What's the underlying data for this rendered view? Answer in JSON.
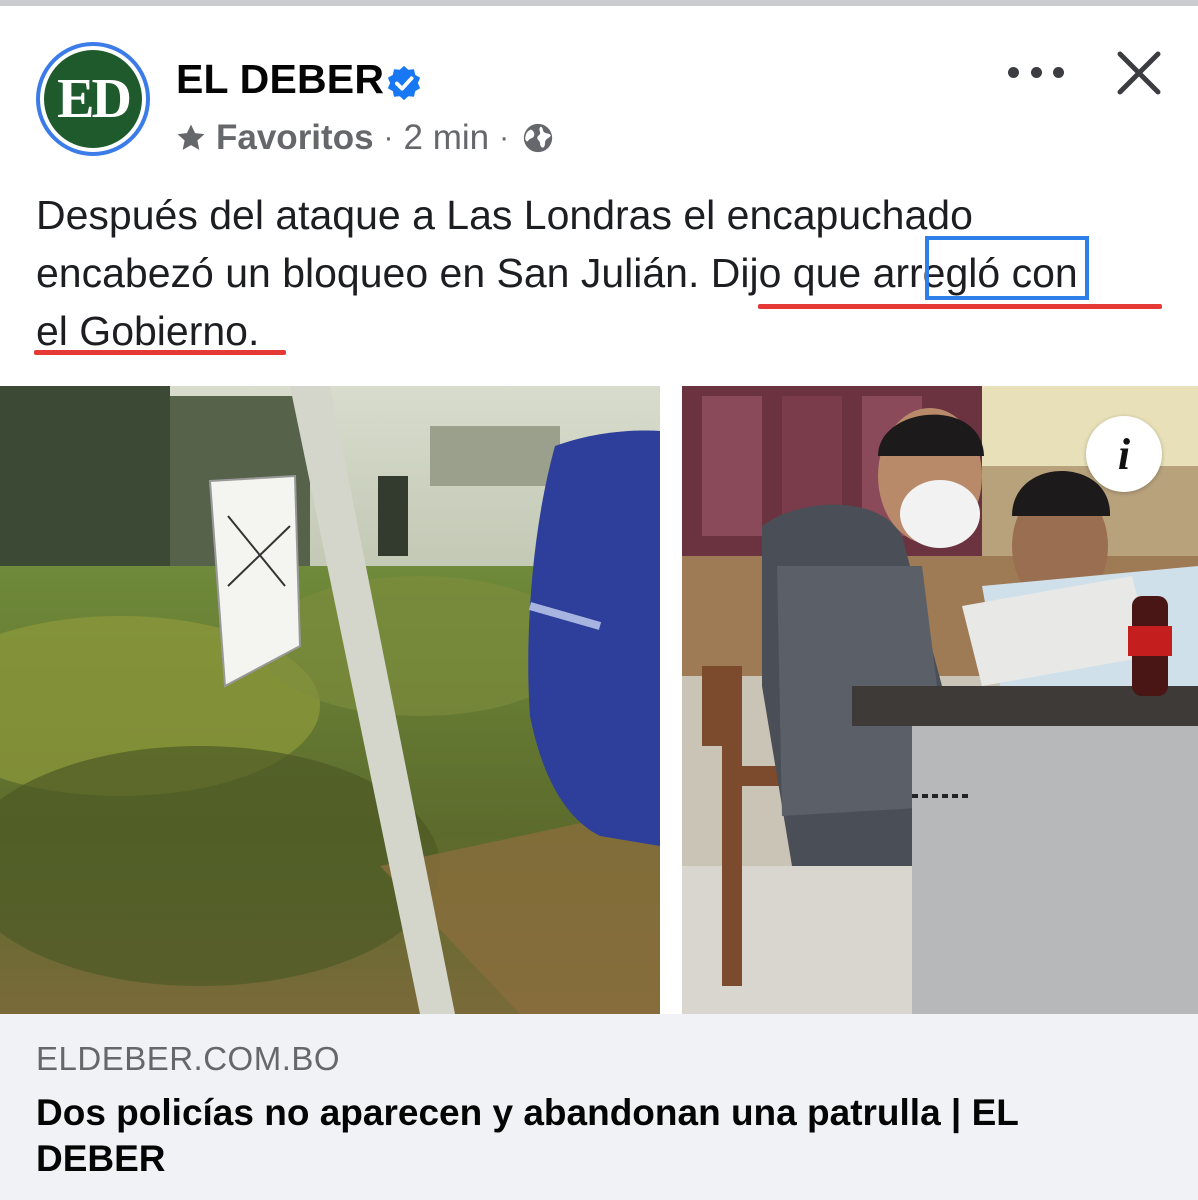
{
  "post": {
    "page_name": "EL DEBER",
    "avatar_text": "ED",
    "audience": "Favoritos",
    "separator": "·",
    "timestamp": "2 min",
    "text_lines": [
      "Después del ataque a Las Londras el encapuchado",
      "encabezó un bloqueo en San Julián. Dijo que arregló con",
      "el Gobierno."
    ]
  },
  "icons": {
    "verified": "verified-badge-icon",
    "star": "star-icon",
    "globe": "globe-icon",
    "more": "more-options-icon",
    "close": "close-icon",
    "info": "info-icon"
  },
  "annotations": {
    "underline_color": "#e53935",
    "box_color": "#2f7fe8"
  },
  "info_glyph": "i",
  "link": {
    "domain": "ELDEBER.COM.BO",
    "title": "Dos policías no aparecen y abandonan una patrulla | EL DEBER"
  },
  "colors": {
    "brand_blue": "#3b7ce8",
    "avatar_green": "#1f5a2c",
    "meta_gray": "#65676b",
    "preview_bg": "#f0f2f5"
  }
}
